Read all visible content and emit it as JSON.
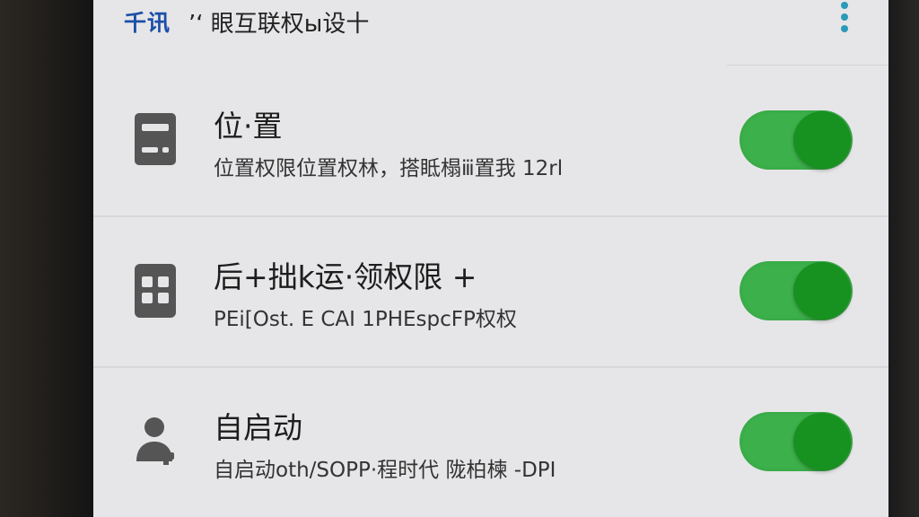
{
  "header": {
    "back_label": "千讯",
    "title": "‎‎‎‎‎‎‎‎"
  },
  "permissions": [
    {
      "title": "位·置",
      "subtitle": "位置权限位置权林，搭眡榻ⅲ置我 12rl",
      "icon": "device-icon",
      "enabled": true
    },
    {
      "title": "后+拙k运·领权限 +",
      "subtitle": "PEi[Ost. E CAI 1PHEspcFP权权",
      "icon": "grid-icon",
      "enabled": true
    },
    {
      "title": "自启动",
      "subtitle": "自启动oth/SOPP·程时代 陇柏楝 -DPI",
      "icon": "user-icon",
      "enabled": true
    }
  ],
  "colors": {
    "accent_blue": "#1c4fa8",
    "toggle_track_on": "#3cb04a",
    "toggle_knob_on": "#17911f",
    "menu_dots": "#2a9ab8"
  }
}
